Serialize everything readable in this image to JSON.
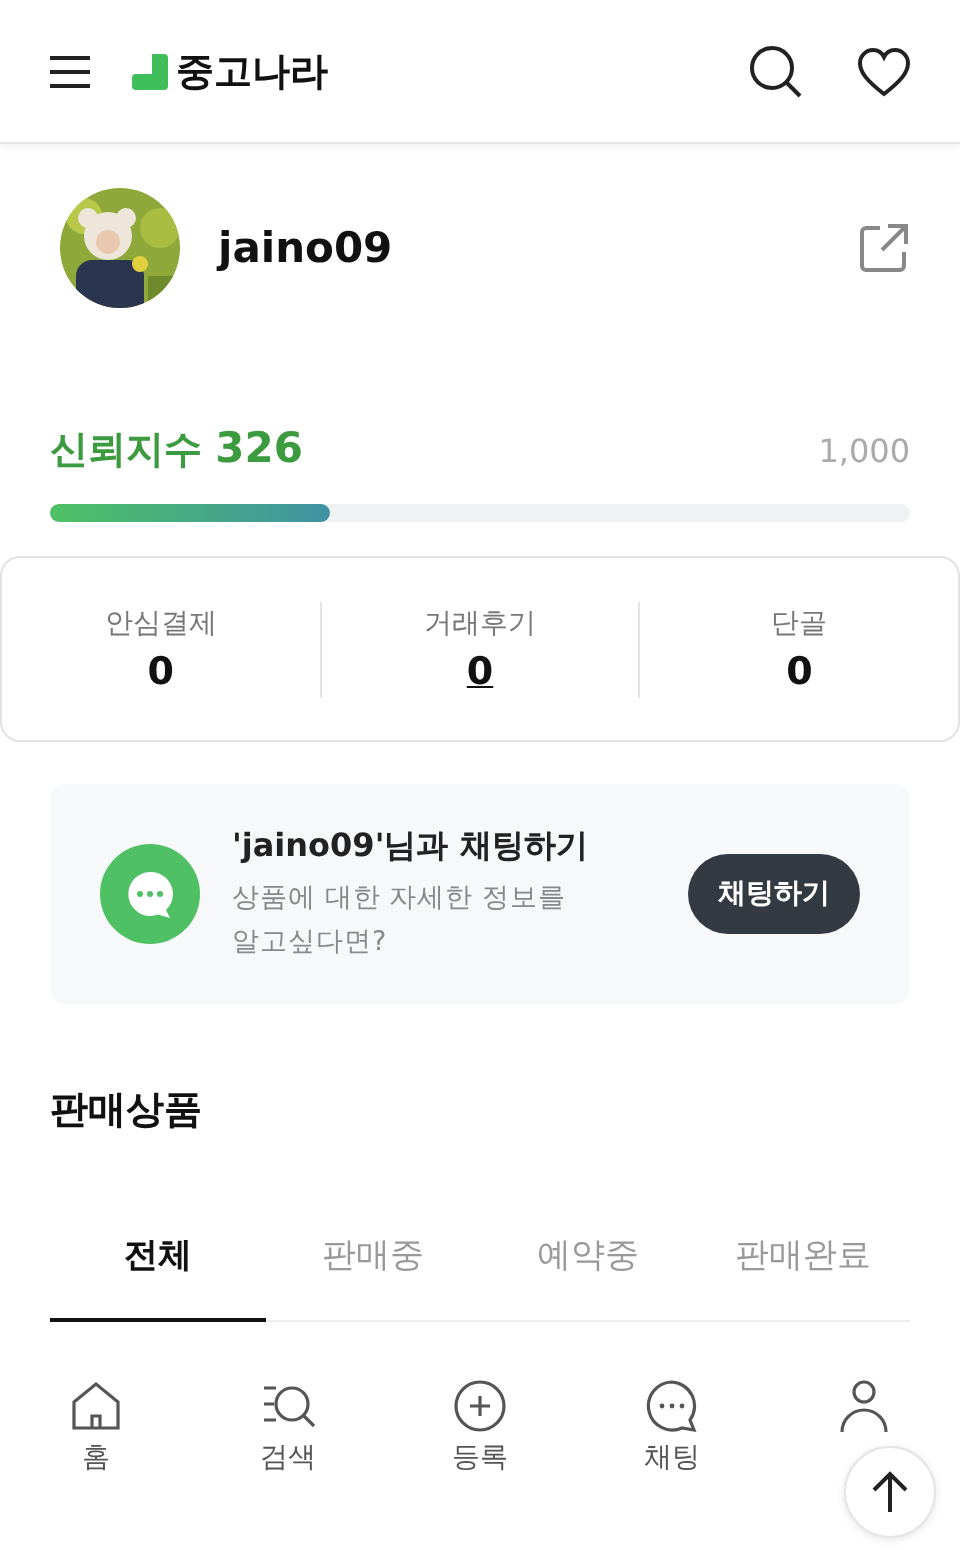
{
  "header": {
    "logo_text": "중고나라"
  },
  "profile": {
    "username": "jaino09"
  },
  "trust": {
    "label": "신뢰지수",
    "score": "326",
    "max": "1,000",
    "level": 0.326
  },
  "stats": [
    {
      "label": "안심결제",
      "value": "0",
      "linked": false
    },
    {
      "label": "거래후기",
      "value": "0",
      "linked": true
    },
    {
      "label": "단골",
      "value": "0",
      "linked": false
    }
  ],
  "chat_card": {
    "title": "'jaino09'님과 채팅하기",
    "description": "상품에 대한 자세한 정보를 알고싶다면?",
    "button": "채팅하기"
  },
  "products": {
    "heading": "판매상품",
    "tabs": [
      {
        "label": "전체",
        "selected": true
      },
      {
        "label": "판매중",
        "selected": false
      },
      {
        "label": "예약중",
        "selected": false
      },
      {
        "label": "판매완료",
        "selected": false
      }
    ]
  },
  "bottom_nav": [
    {
      "kind": "home",
      "label": "홈"
    },
    {
      "kind": "search",
      "label": "검색"
    },
    {
      "kind": "add",
      "label": "등록"
    },
    {
      "kind": "chat",
      "label": "채팅"
    },
    {
      "kind": "profile"
    }
  ]
}
